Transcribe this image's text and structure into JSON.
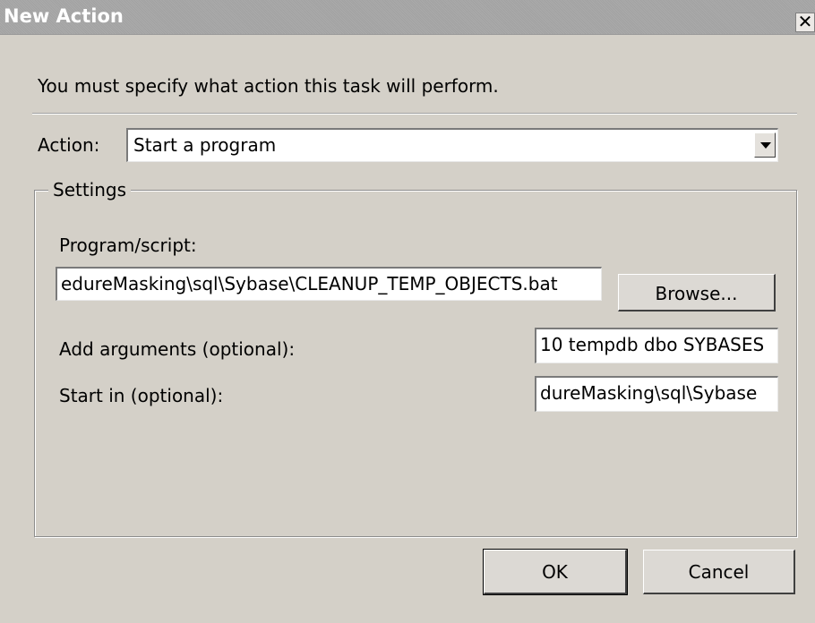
{
  "window": {
    "title": "New Action",
    "close_symbol": "✕"
  },
  "instructions": "You must specify what action this task will perform.",
  "action": {
    "label": "Action:",
    "selected": "Start a program"
  },
  "settings": {
    "group_label": "Settings",
    "program": {
      "label": "Program/script:",
      "value": "edureMasking\\sql\\Sybase\\CLEANUP_TEMP_OBJECTS.bat",
      "browse_label": "Browse..."
    },
    "arguments": {
      "label": "Add arguments (optional):",
      "value": "10 tempdb dbo SYBASES"
    },
    "start_in": {
      "label": "Start in (optional):",
      "value": "dureMasking\\sql\\Sybase"
    }
  },
  "buttons": {
    "ok": "OK",
    "cancel": "Cancel"
  },
  "colors": {
    "dialog_bg": "#d4d0c8",
    "titlebar": "#a6a6a6"
  }
}
